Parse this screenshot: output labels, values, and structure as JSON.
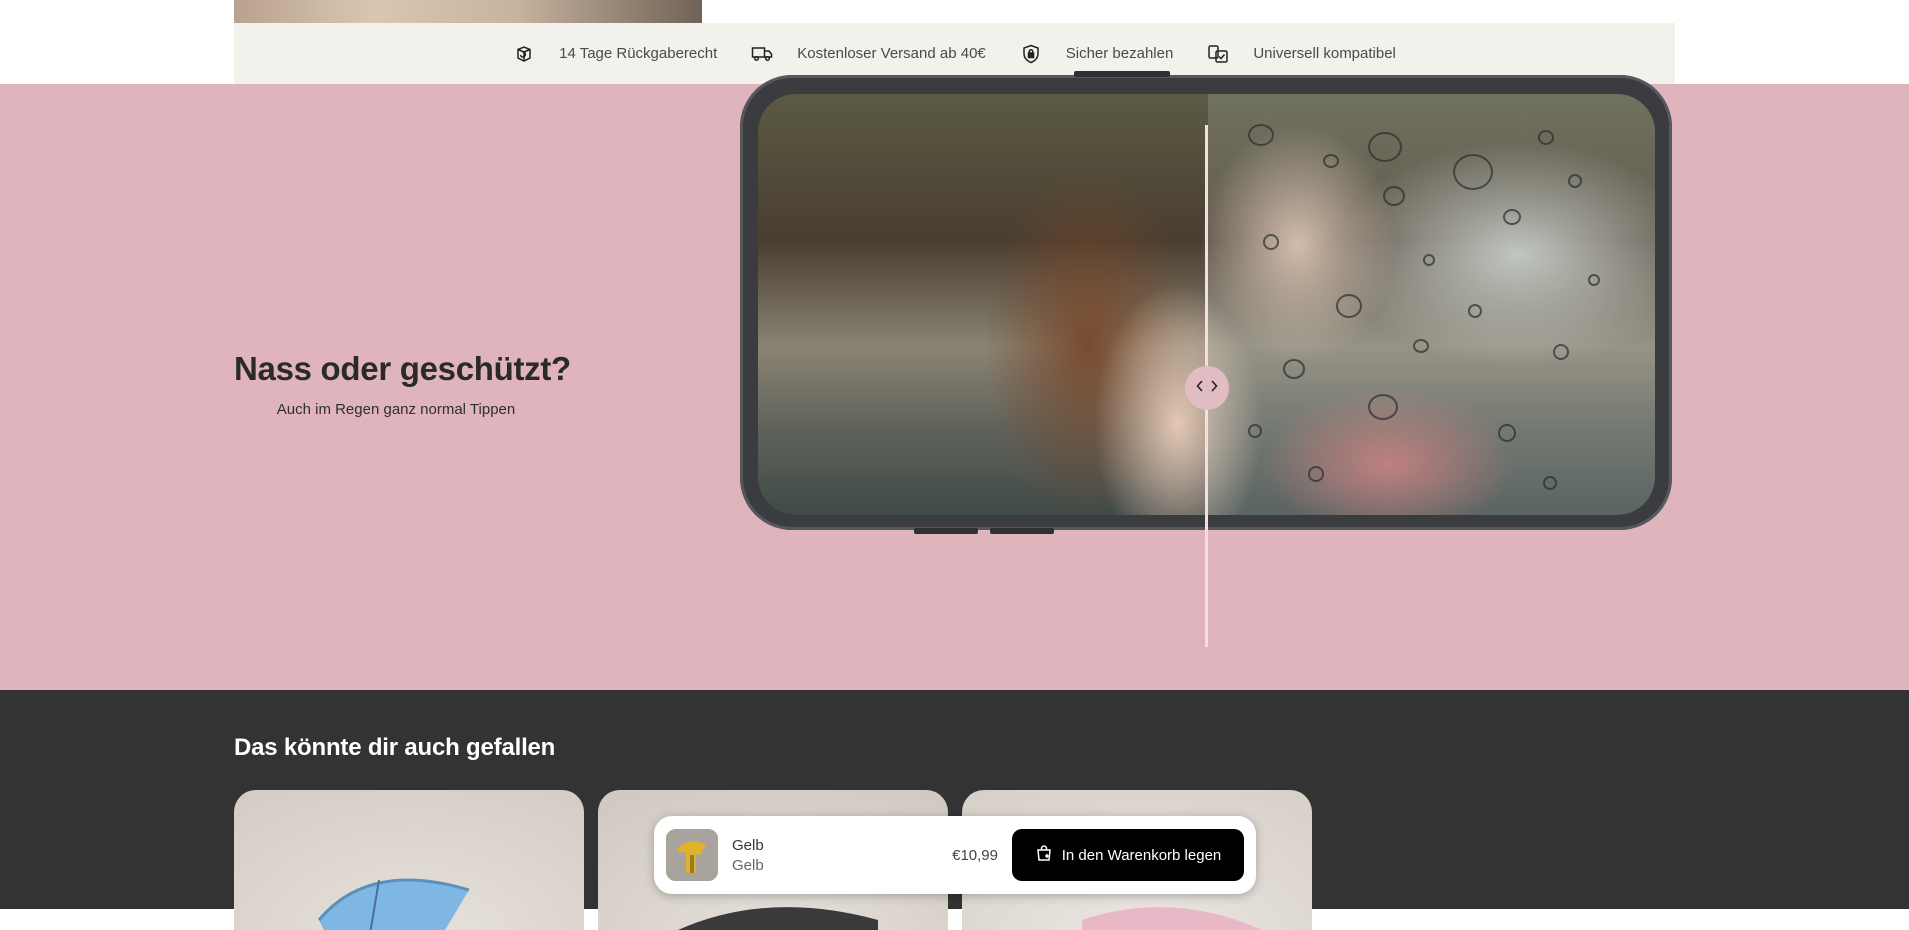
{
  "trust_bar": {
    "items": [
      {
        "icon": "return-box-icon",
        "label": "14 Tage Rückgaberecht"
      },
      {
        "icon": "delivery-truck-icon",
        "label": "Kostenloser Versand ab 40€"
      },
      {
        "icon": "shield-icon",
        "label": "Sicher bezahlen"
      },
      {
        "icon": "compatibility-icon",
        "label": "Universell kompatibel"
      }
    ]
  },
  "compare": {
    "title": "Nass oder geschützt?",
    "subtitle": "Auch im Regen ganz normal Tippen",
    "handle_icon": "chevron-left-right-icon",
    "background_color": "#e0b4bc"
  },
  "recommendations": {
    "title": "Das könnte dir auch gefallen",
    "cards": [
      {
        "umbrella_color": "#7eb6e4"
      },
      {
        "umbrella_color": "#3a3a3a"
      },
      {
        "umbrella_color": "#e8b8c6"
      }
    ]
  },
  "sticky_cart": {
    "product_name": "Gelb",
    "variant": "Gelb",
    "price": "€10,99",
    "button_label": "In den Warenkorb legen",
    "button_icon": "shopping-bag-icon"
  }
}
